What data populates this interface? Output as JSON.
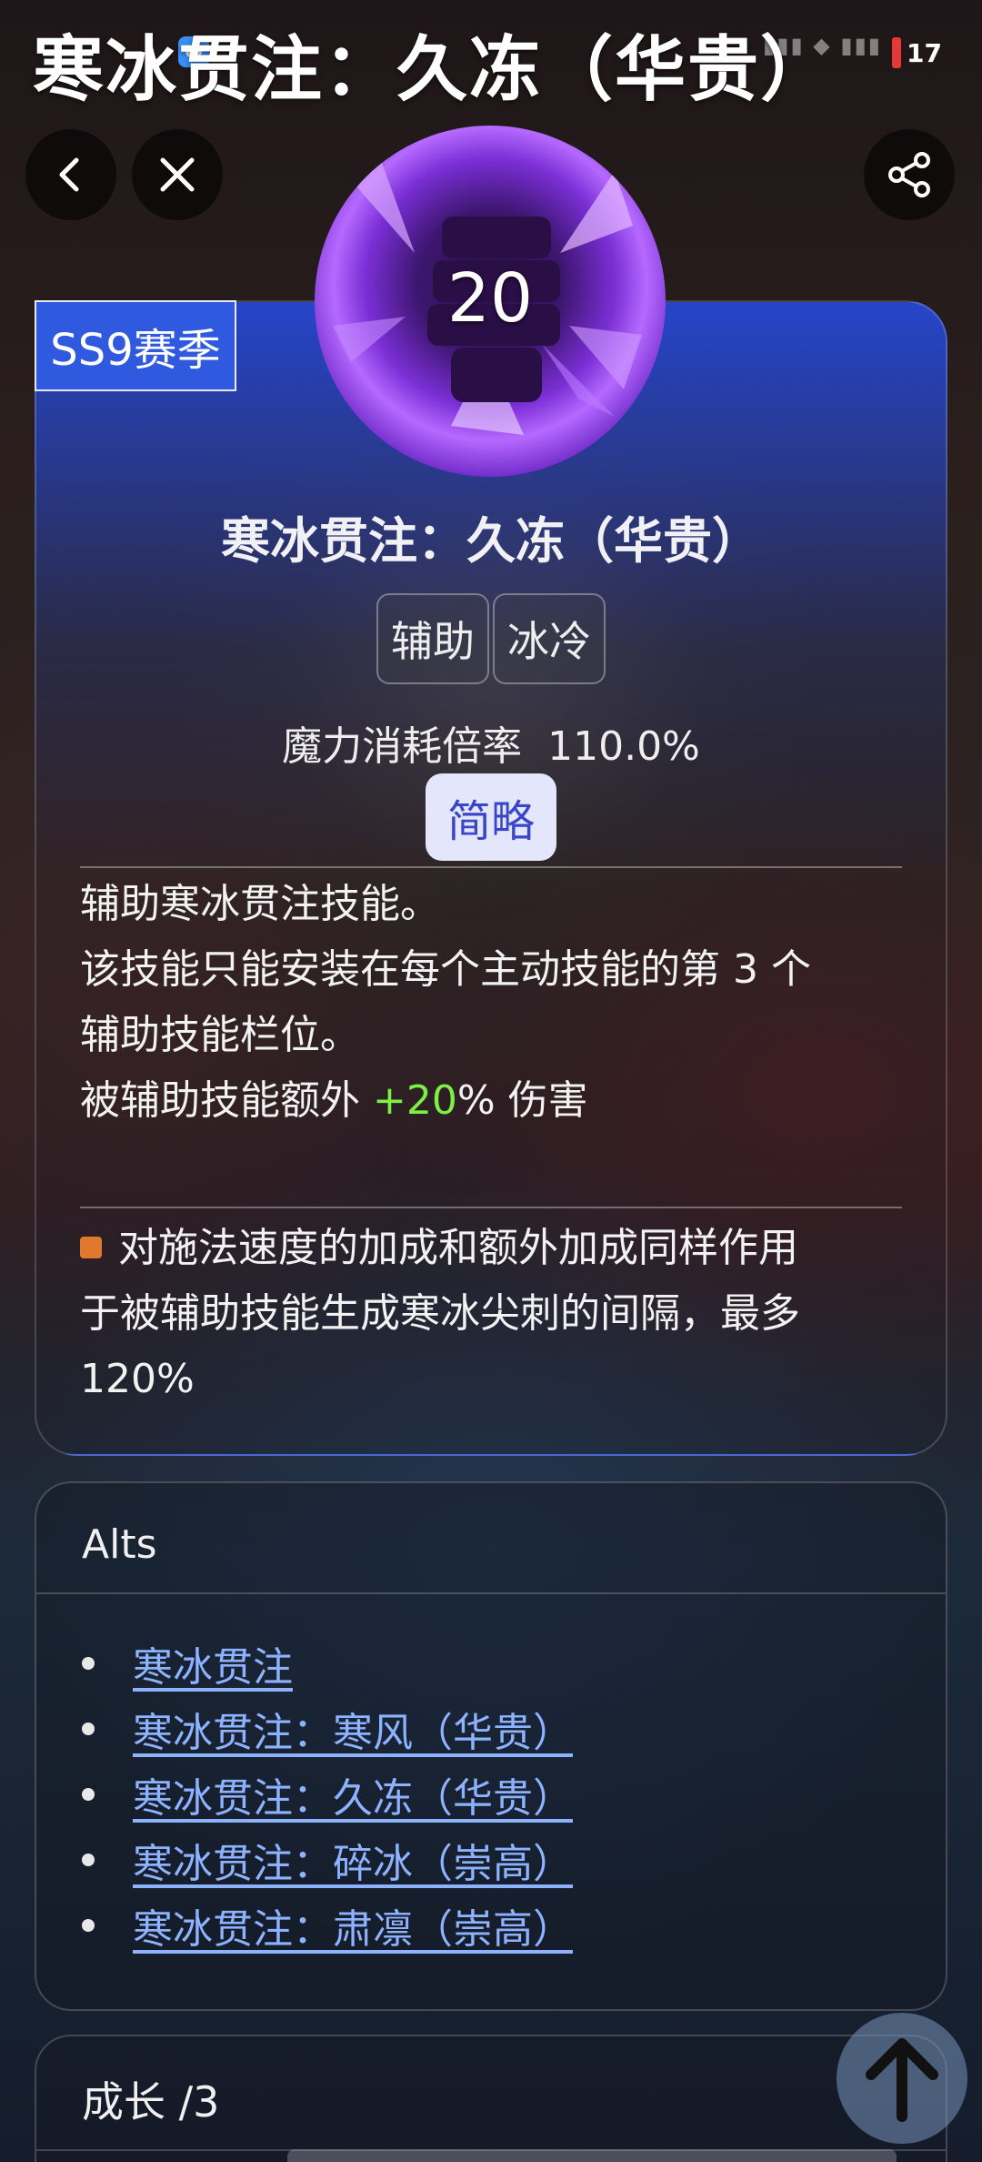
{
  "status_bar": {
    "time": "",
    "battery": "17"
  },
  "header": {
    "title": "寒冰贯注：久冻（华贵）"
  },
  "skill": {
    "season_badge": "SS9赛季",
    "level": "20",
    "name": "寒冰贯注：久冻（华贵）",
    "tags": [
      "辅助",
      "冰冷"
    ],
    "mana_label": "魔力消耗倍率",
    "mana_value": "110.0%",
    "brief_button": "简略",
    "description": {
      "line1": "辅助寒冰贯注技能。",
      "line2": "该技能只能安装在每个主动技能的第 3 个",
      "line3": "辅助技能栏位。",
      "line4_prefix": "被辅助技能额外 ",
      "line4_value": "+20",
      "line4_suffix": "% 伤害"
    },
    "modifier": {
      "line1": "对施法速度的加成和额外加成同样作用",
      "line2": "于被辅助技能生成寒冰尖刺的间隔，最多",
      "line3": "120%"
    }
  },
  "alts": {
    "title": "Alts",
    "items": [
      "寒冰贯注",
      "寒冰贯注：寒风（华贵）",
      "寒冰贯注：久冻（华贵）",
      "寒冰贯注：碎冰（崇高）",
      "寒冰贯注：肃凛（崇高）"
    ]
  },
  "growth": {
    "title": "成长 /3"
  },
  "icons": {
    "back": "chevron-left-icon",
    "close": "close-icon",
    "share": "share-icon",
    "scroll_top": "arrow-up-icon",
    "skill": "fist-icon"
  },
  "colors": {
    "card_blue": "#2f5ae0",
    "green_value": "#7cf045",
    "link": "#8db2ff",
    "modifier_bullet": "#e07830"
  }
}
